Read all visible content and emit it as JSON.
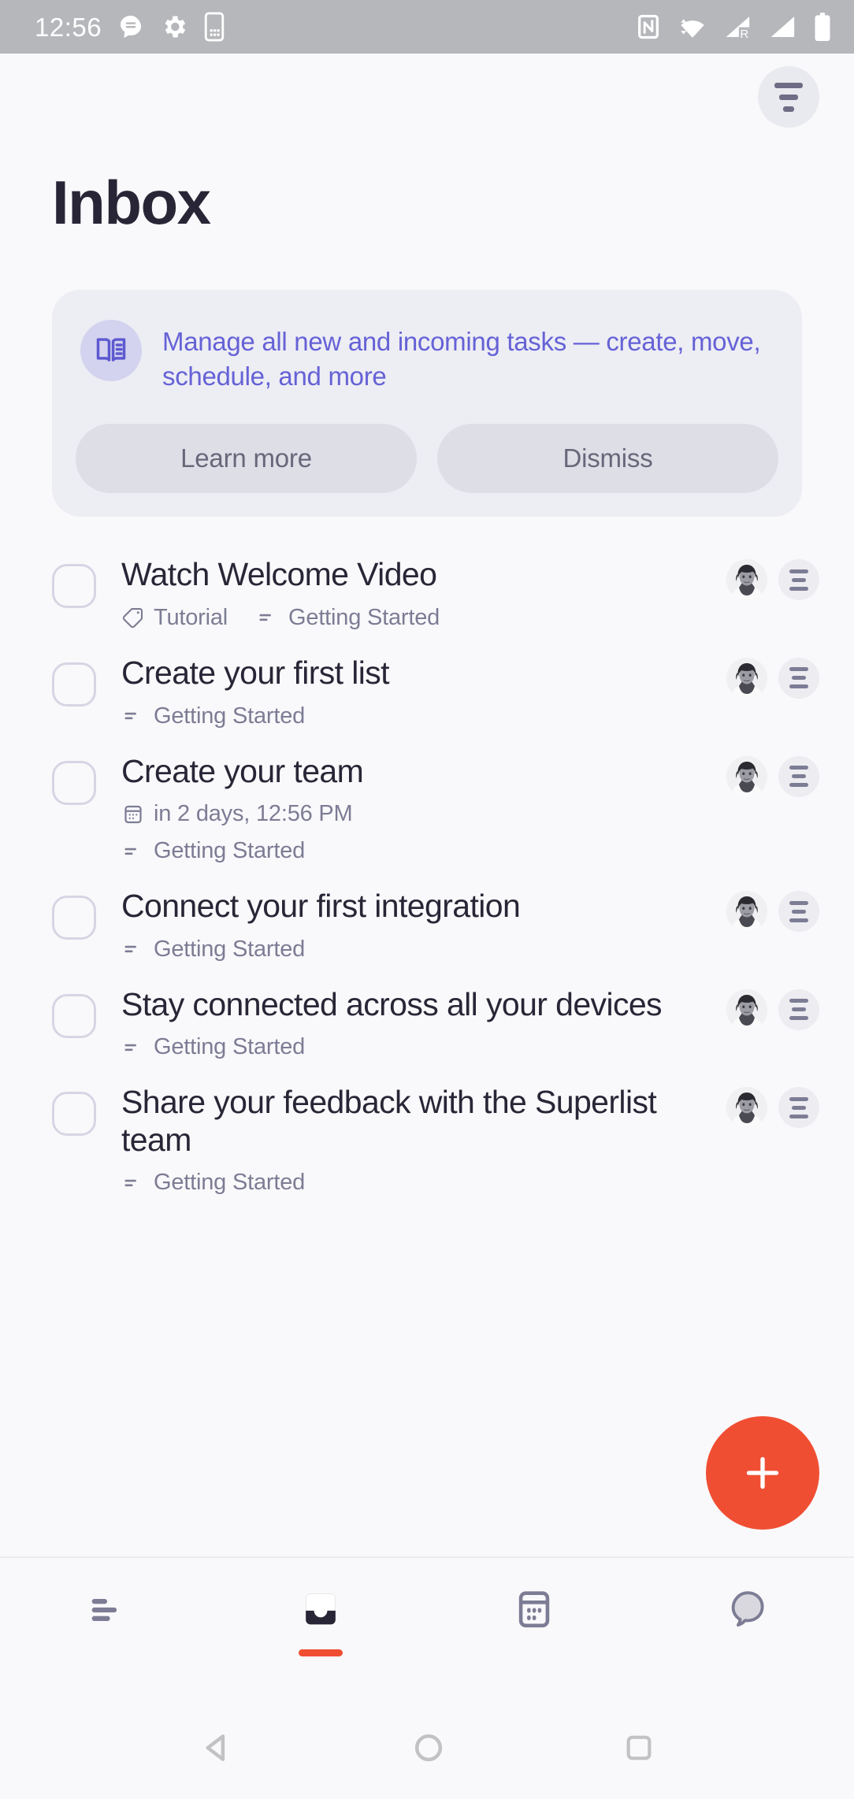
{
  "statusbar": {
    "time": "12:56",
    "left_icons": [
      "message-icon",
      "gear-icon",
      "sim-card-icon"
    ],
    "right_icons": [
      "nfc-icon",
      "wifi-icon",
      "cellular-roaming-icon",
      "cellular-signal-icon",
      "battery-icon"
    ]
  },
  "header": {
    "title": "Inbox",
    "filter_button": "filter-icon"
  },
  "banner": {
    "icon": "open-book-icon",
    "message": "Manage all new and incoming tasks — create, move, schedule, and more",
    "learn_more_label": "Learn more",
    "dismiss_label": "Dismiss",
    "background": "#EDEDF4",
    "text_color": "#6562D6",
    "button_background": "#DEDEE7"
  },
  "tasks": [
    {
      "title": "Watch Welcome Video",
      "meta": [
        {
          "icon": "tag-icon",
          "label": "Tutorial"
        },
        {
          "icon": "list-icon",
          "label": "Getting Started"
        }
      ]
    },
    {
      "title": "Create your first list",
      "meta": [
        {
          "icon": "list-icon",
          "label": "Getting Started"
        }
      ]
    },
    {
      "title": "Create your team",
      "meta": [
        {
          "icon": "calendar-icon",
          "label": "in 2 days, 12:56 PM"
        },
        {
          "icon": "list-icon",
          "label": "Getting Started"
        }
      ]
    },
    {
      "title": "Connect your first integration",
      "meta": [
        {
          "icon": "list-icon",
          "label": "Getting Started"
        }
      ]
    },
    {
      "title": "Stay connected across all your devices",
      "meta": [
        {
          "icon": "list-icon",
          "label": "Getting Started"
        }
      ]
    },
    {
      "title": "Share your feedback with the Superlist team",
      "meta": [
        {
          "icon": "list-icon",
          "label": "Getting Started"
        }
      ]
    }
  ],
  "fab": {
    "icon": "plus-icon",
    "color": "#F04E33"
  },
  "bottomnav": {
    "items": [
      {
        "icon": "lists-icon",
        "active": false
      },
      {
        "icon": "inbox-icon",
        "active": true
      },
      {
        "icon": "calendar-icon",
        "active": false
      },
      {
        "icon": "chat-icon",
        "active": false
      }
    ],
    "active_indicator_color": "#F04E33"
  },
  "sysnav": {
    "back": "back-triangle-icon",
    "home": "home-circle-icon",
    "recents": "recents-square-icon"
  }
}
